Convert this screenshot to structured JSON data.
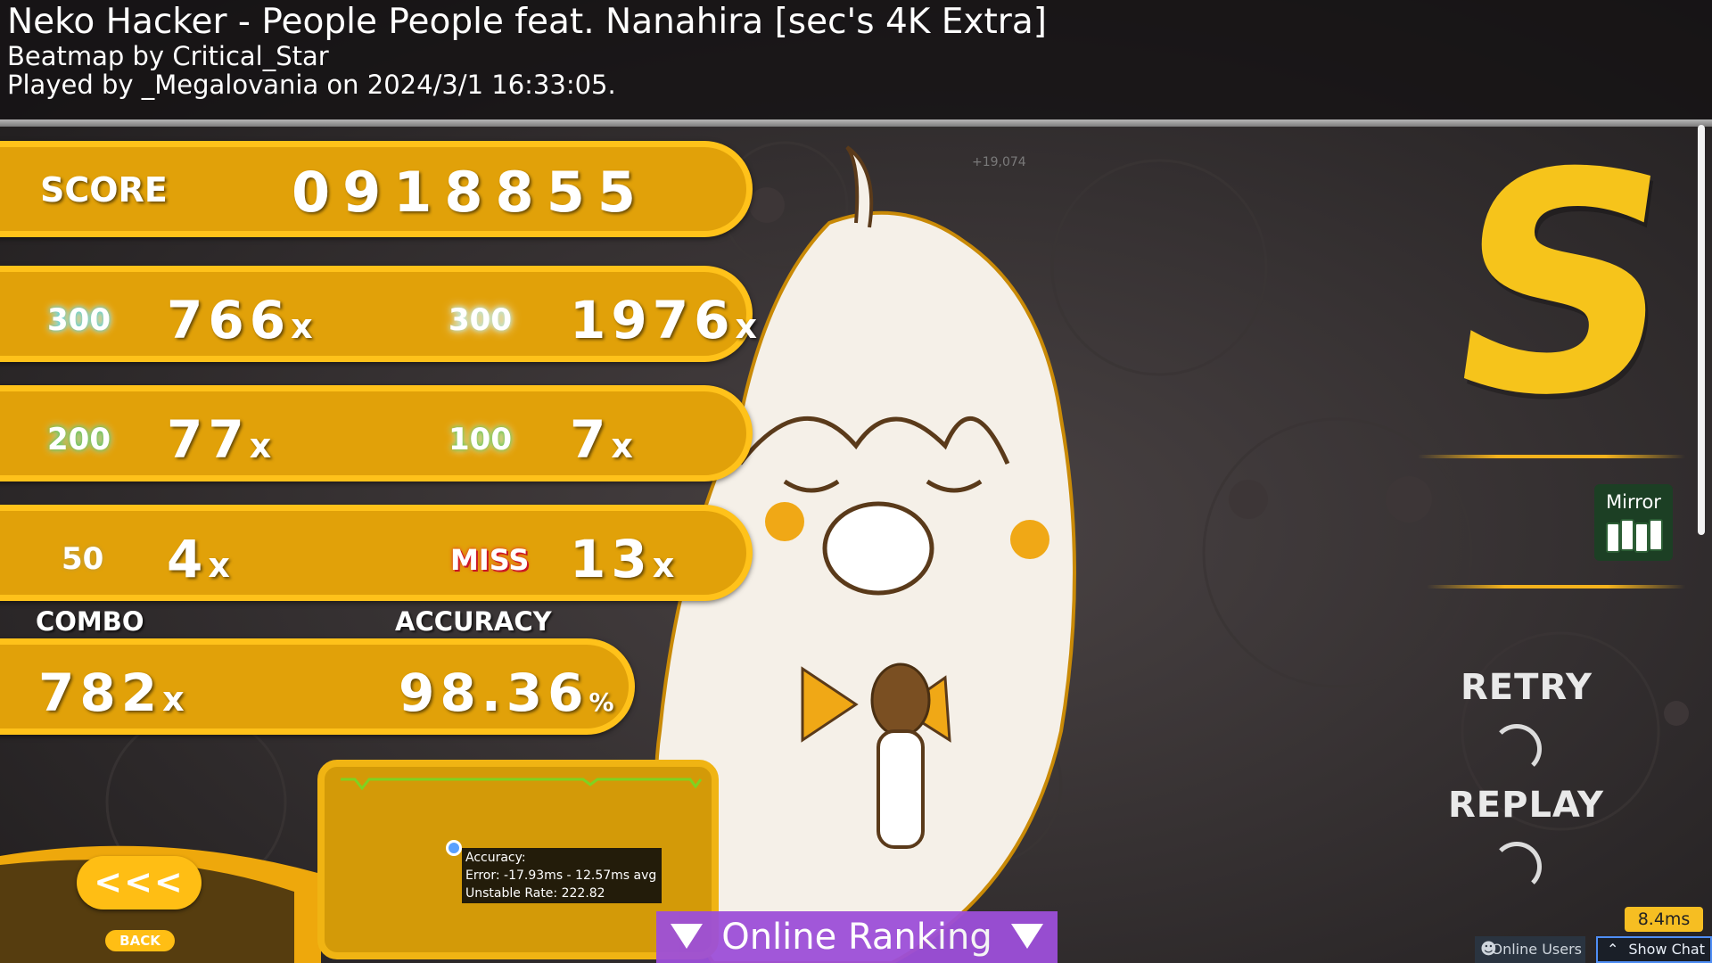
{
  "header": {
    "title": "Neko Hacker - People People feat. Nanahira [sec's 4K Extra]",
    "beatmap_by": "Beatmap by Critical_Star",
    "played_by": "Played by _Megalovania on 2024/3/1 16:33:05."
  },
  "score": {
    "label": "SCORE",
    "value": "0918855"
  },
  "judgements": {
    "max300": {
      "icon_label": "300",
      "count": "766",
      "suffix": "x"
    },
    "great300": {
      "icon_label": "300",
      "count": "1976",
      "suffix": "x"
    },
    "good200": {
      "icon_label": "200",
      "count": "77",
      "suffix": "x"
    },
    "ok100": {
      "icon_label": "100",
      "count": "7",
      "suffix": "x"
    },
    "meh50": {
      "icon_label": "50",
      "count": "4",
      "suffix": "x"
    },
    "miss": {
      "icon_label": "MISS",
      "count": "13",
      "suffix": "x"
    }
  },
  "combo": {
    "label": "COMBO",
    "value": "782",
    "suffix": "x"
  },
  "accuracy": {
    "label": "ACCURACY",
    "value": "98.36",
    "suffix": "%"
  },
  "score_gain": "+19,074",
  "graph_tooltip": {
    "line1": "Accuracy:",
    "line2": "Error: -17.93ms - 12.57ms avg",
    "line3": "Unstable Rate: 222.82"
  },
  "online_ranking": "Online Ranking",
  "back": {
    "arrows": "<<<",
    "label": "BACK"
  },
  "grade": "S",
  "mods": [
    {
      "name": "Mirror",
      "icon": "piano-keys-icon"
    }
  ],
  "side_buttons": {
    "retry": "RETRY",
    "replay": "REPLAY"
  },
  "frame_time": "8.4ms",
  "online_users": "Online Users",
  "show_chat": "Show Chat",
  "colors": {
    "panel": "#e1a109",
    "panel_border": "#ffc21a",
    "grade": "#f6c41b",
    "online_ranking": "#9d4fd9"
  }
}
